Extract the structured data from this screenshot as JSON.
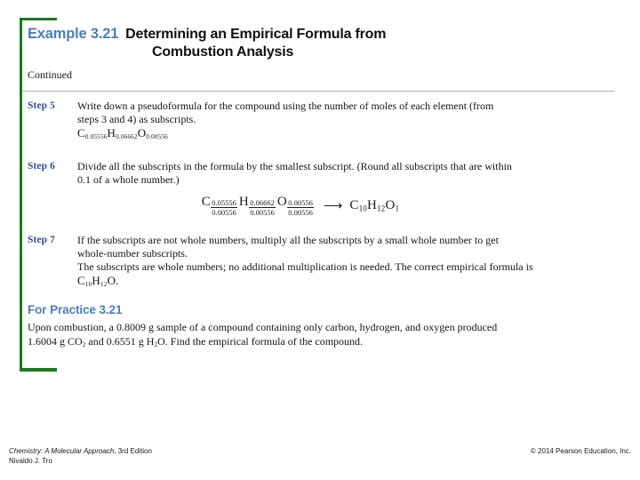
{
  "slide": {
    "example_label": "Example 3.21",
    "title_line1": "Determining an Empirical Formula from",
    "title_line2": "Combustion Analysis",
    "continued": "Continued"
  },
  "steps": [
    {
      "label": "Step 5",
      "line1": "Write down a pseudoformula for the compound using the number of moles of each element (from",
      "line2": "steps 3 and 4) as subscripts.",
      "formula": {
        "c_sub": "0.05556",
        "h_sub": "0.06662",
        "o_sub": "0.00556"
      }
    },
    {
      "label": "Step 6",
      "line1": "Divide all the subscripts in the formula by the smallest subscript. (Round all subscripts that are within",
      "line2": "0.1 of a whole number.)"
    },
    {
      "label": "Step 7",
      "line1": "If the subscripts are not whole numbers, multiply all the subscripts by a small whole number to get",
      "line2": "whole-number subscripts.",
      "line3": "The subscripts are whole numbers; no additional multiplication is needed. The correct empirical formula is",
      "result": {
        "c_sub": "10",
        "h_sub": "12"
      }
    }
  ],
  "equation": {
    "terms": [
      {
        "element": "C",
        "numerator": "0.05556",
        "denominator": "0.00556"
      },
      {
        "element": "H",
        "numerator": "0.06662",
        "denominator": "0.00556"
      },
      {
        "element": "O",
        "numerator": "0.00556",
        "denominator": "0.00556"
      }
    ],
    "arrow": "⟶",
    "result": {
      "c": "C",
      "c_sub": "10",
      "h": "H",
      "h_sub": "12",
      "o": "O",
      "o_sub": "1"
    }
  },
  "practice": {
    "heading": "For Practice 3.21",
    "line1_a": "Upon combustion, a 0.8009 g sample of a compound containing only carbon, hydrogen, and oxygen produced",
    "line2_a": "1.6004 g CO",
    "line2_co2_sub": "2",
    "line2_b": " and 0.6551 g H",
    "line2_h2o_sub": "2",
    "line2_c": "O. Find the empirical formula of the compound."
  },
  "footer": {
    "book_title": "Chemistry: A Molecular Approach",
    "edition": ", 3rd Edition",
    "author": "Nivaldo J. Tro",
    "copyright": "© 2014 Pearson Education, Inc."
  },
  "colors": {
    "accent_blue": "#4a7ebb",
    "step_blue": "#2b4f9e",
    "frame_green": "#1d7a21",
    "rule_gray": "#b3b3b3"
  }
}
